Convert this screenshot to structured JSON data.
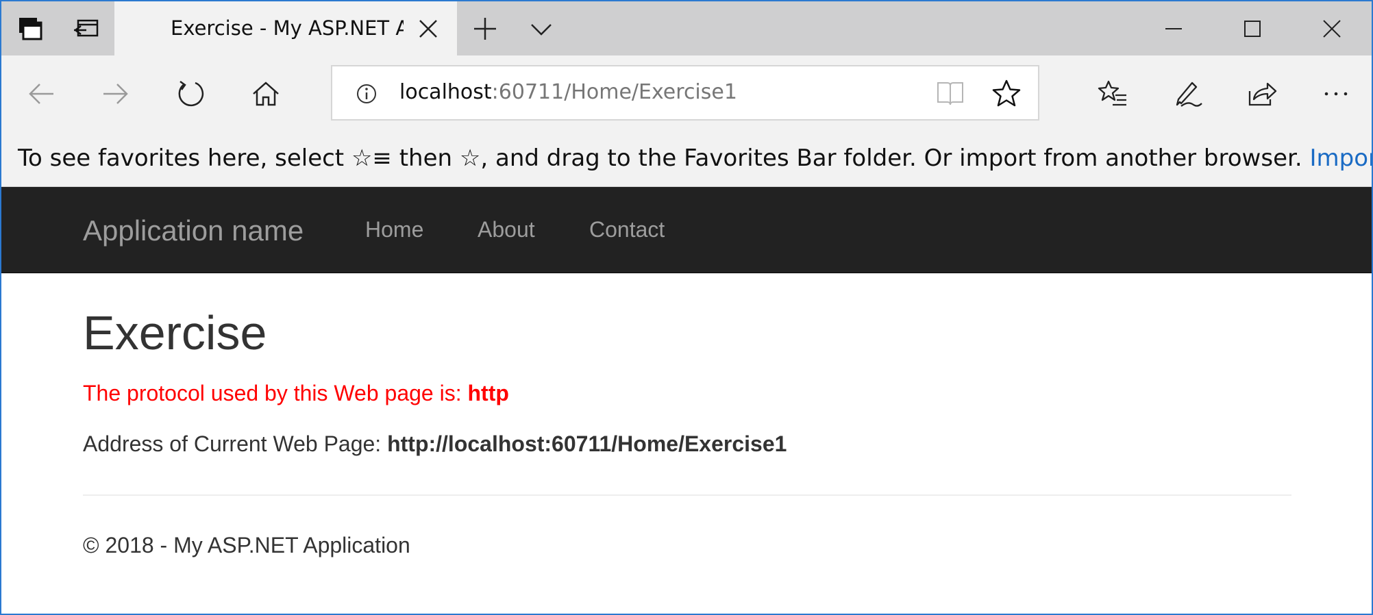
{
  "browser": {
    "tab": {
      "title": "Exercise - My ASP.NET A"
    },
    "address": {
      "host": "localhost",
      "rest": ":60711/Home/Exercise1"
    },
    "favorites_bar": {
      "text_a": "To see favorites here, select ",
      "icon_a": "☆≡",
      "text_b": " then ",
      "icon_b": "☆",
      "text_c": ", and drag to the Favorites Bar folder. Or import from another browser. ",
      "link": "Import favorites"
    },
    "icons": [
      "tab-aside-icon",
      "tab-restore-icon",
      "close-icon",
      "plus-icon",
      "chevron-down-icon",
      "minimize-icon",
      "maximize-icon",
      "back-icon",
      "forward-icon",
      "refresh-icon",
      "home-icon",
      "info-icon",
      "reading-view-icon",
      "star-icon",
      "favorites-icon",
      "pen-icon",
      "share-icon",
      "more-icon"
    ]
  },
  "site": {
    "brand": "Application name",
    "nav": [
      "Home",
      "About",
      "Contact"
    ]
  },
  "main": {
    "heading": "Exercise",
    "protocol_label": "The protocol used by this Web page is: ",
    "protocol_value": "http",
    "address_label": "Address of Current Web Page: ",
    "address_value": "http://localhost:60711/Home/Exercise1"
  },
  "footer": {
    "text": "© 2018 - My ASP.NET Application"
  },
  "colors": {
    "navbar": "#222222",
    "nav_text": "#9d9d9d",
    "protocol": "#ff0000",
    "link": "#1a6bc4",
    "window_border": "#2b79d0"
  }
}
